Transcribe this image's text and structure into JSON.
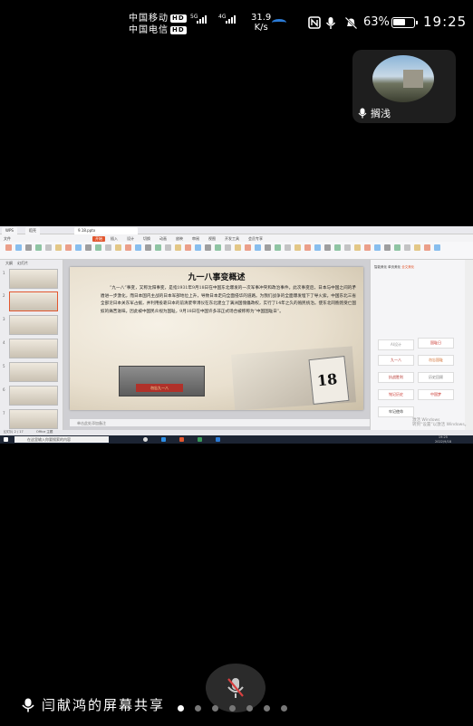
{
  "status_bar": {
    "carrier_1": "中国移动",
    "carrier_2": "中国电信",
    "hd_badge": "HD",
    "sig_5g": "5G",
    "sig_4g": "4G",
    "net_speed_value": "31.9",
    "net_speed_unit": "K/s",
    "battery_pct": "63%",
    "battery_level": 0.63,
    "time": "19:25"
  },
  "participant": {
    "name": "搁浅"
  },
  "shared_screen": {
    "tabs": [
      "WPS",
      "稻壳",
      "9.18.pptx"
    ],
    "menu": [
      "文件",
      "开始",
      "插入",
      "设计",
      "切换",
      "动画",
      "放映",
      "审阅",
      "视图",
      "开发工具",
      "会员专享"
    ],
    "thumb_tabs": [
      "大纲",
      "幻灯片"
    ],
    "slide": {
      "title": "九一八事变概述",
      "body": "“九一八”事变，又称沈阳事变，是指1931年9月18日在中国东北爆发的一次军事冲突和政治事件。此次事变后，日本与中国之间的矛盾进一步激化，而日本国内主战的日本军部地位上升，导致日本走向全面侵华的道路。为我们战争的全面爆发埋下了导火索。中国东北三省全部沦日本关东军占据，并利用投靠日本的前清废帝溥仪在东北建立了满洲国傀儡政权，实行了14年之久的殖民统治。使东北同胞饱受亡国奴的痛苦滋味。因此被中国民众视为国耻，9月18日在中国许多非正式场合被称称为“中国国耻日”。",
      "photo_caption": "勿忘九一八",
      "calendar_number": "18"
    },
    "notes_placeholder": "单击此处添加备注",
    "right_pane_tabs": [
      "智能美化",
      "单页美化",
      "全文美化"
    ],
    "right_pane_tiles": [
      "AI设计",
      "国耻日",
      "九一八",
      "勿忘国耻",
      "抗战胜利",
      "历史回顾",
      "铭记历史",
      "中国梦",
      "牢记使命"
    ],
    "watermark_line_1": "激活 Windows",
    "watermark_line_2": "转到“设置”以激活 Windows。",
    "wps_status": [
      "幻灯片 2 / 17",
      "Office 主题"
    ],
    "taskbar_search": "在这里输入你要搜索的内容",
    "taskbar_time": "19:25",
    "taskbar_date": "2022/9/18"
  },
  "bottom": {
    "share_label": "闫献鸿的屏幕共享",
    "page_dots": 7,
    "active_dot": 0
  }
}
